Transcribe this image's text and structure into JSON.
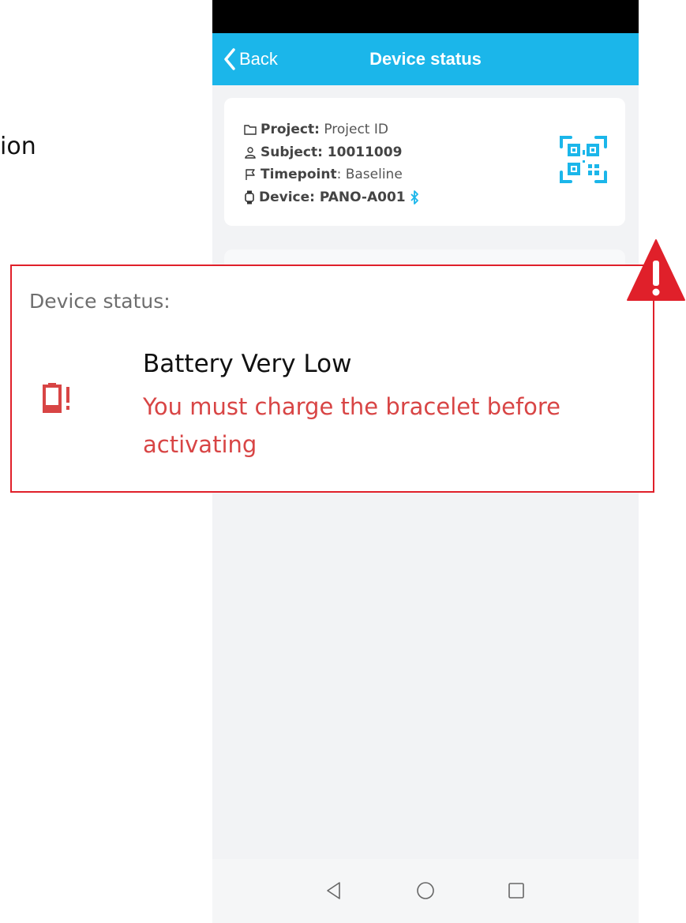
{
  "background": {
    "partial_text": "ion"
  },
  "colors": {
    "header": "#1bb6ea",
    "accent": "#1bb6ea",
    "warning": "#e0202a",
    "alert_text": "#d84545"
  },
  "header": {
    "back_label": "Back",
    "title": "Device status",
    "back_icon": "chevron-left-icon"
  },
  "info": {
    "project": {
      "key": "Project",
      "value": "Project ID",
      "icon": "folder-icon"
    },
    "subject": {
      "text": "Subject: 10011009",
      "icon": "person-icon"
    },
    "timepoint": {
      "key": "Timepoint",
      "value": "Baseline",
      "icon": "flag-icon"
    },
    "device": {
      "text": "Device: PANO-A001",
      "icon": "watch-icon",
      "status_icon": "bluetooth-icon"
    },
    "qr_icon": "qr-scan-icon"
  },
  "callout": {
    "title": "Device status:",
    "heading": "Battery Very Low",
    "message": "You must charge the bracelet before activating",
    "icon": "battery-low-icon",
    "warning_icon": "warning-triangle-icon"
  },
  "nav": {
    "back_icon": "nav-back-icon",
    "home_icon": "nav-home-icon",
    "recents_icon": "nav-recents-icon"
  }
}
